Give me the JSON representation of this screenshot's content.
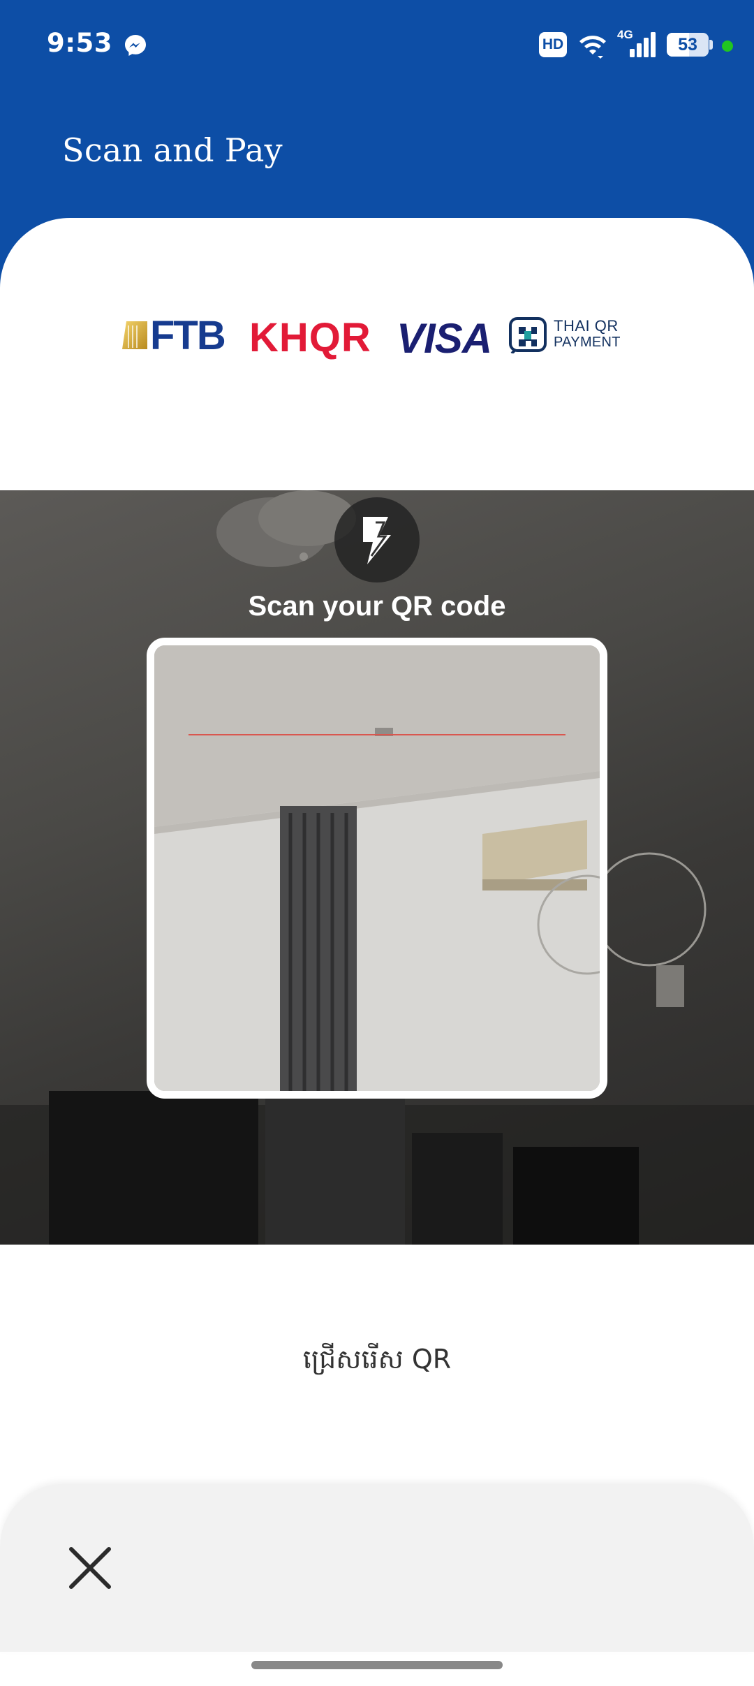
{
  "status_bar": {
    "time": "9:53",
    "notification_icon": "messenger-icon",
    "hd_label": "HD",
    "network_label": "4G",
    "battery_percent": "53",
    "battery_level": 0.53
  },
  "header": {
    "title": "Scan and Pay",
    "background_color": "#0d4ea6"
  },
  "logos": {
    "ftb": "FTB",
    "khqr": "KHQR",
    "visa": "VISA",
    "thai_qr_line1": "THAI QR",
    "thai_qr_line2": "PAYMENT"
  },
  "scanner": {
    "flash_icon": "flash-icon",
    "instruction": "Scan your QR code",
    "scan_line_color": "#d9574f"
  },
  "actions": {
    "choose_qr": "ជ្រើសរើស QR",
    "close_icon": "close-icon"
  }
}
